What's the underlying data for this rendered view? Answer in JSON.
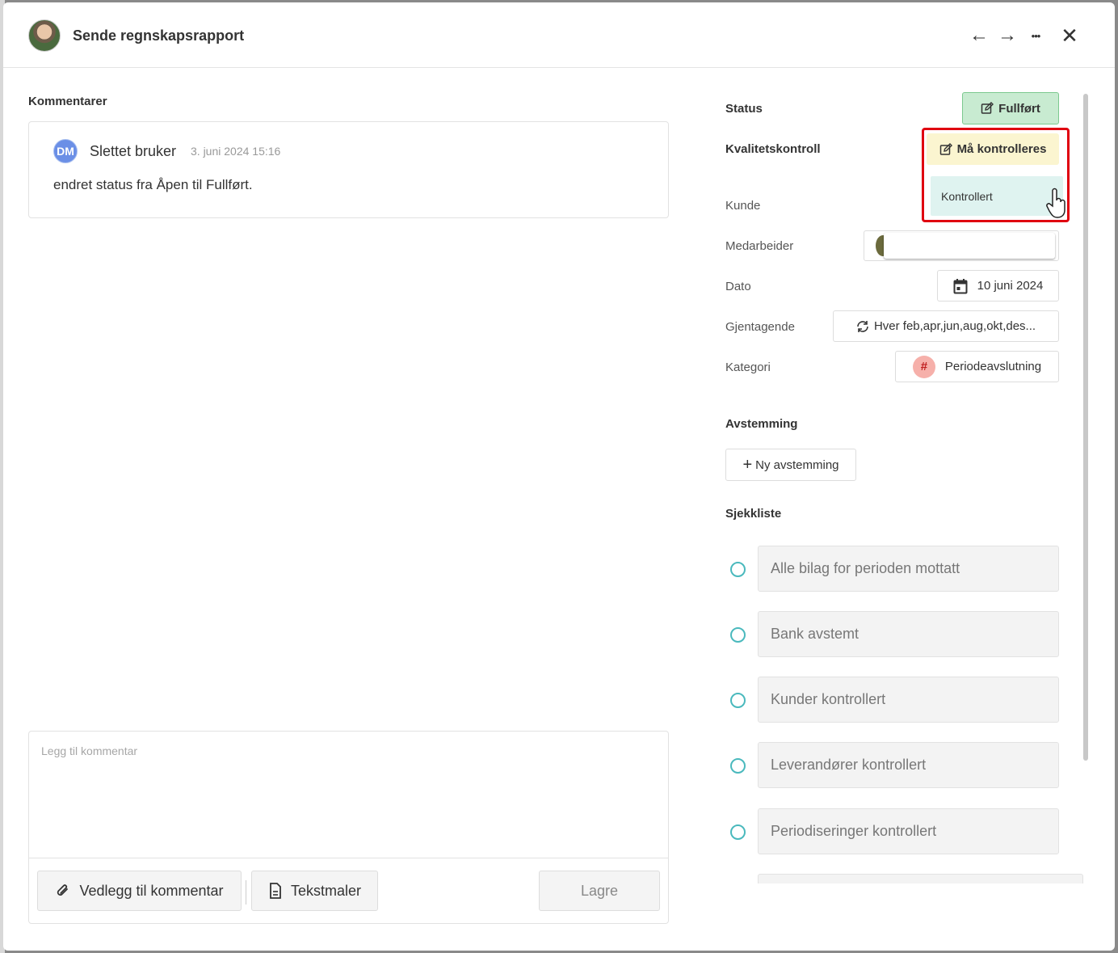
{
  "header": {
    "title": "Sende regnskapsrapport",
    "prev_icon": "←",
    "next_icon": "→",
    "more_icon": "•••",
    "close_icon": "✕"
  },
  "comments": {
    "section_label": "Kommentarer",
    "items": [
      {
        "avatar_initials": "DM",
        "author": "Slettet bruker",
        "timestamp": "3. juni 2024 15:16",
        "text": "endret status fra Åpen til Fullført."
      }
    ],
    "composer": {
      "placeholder": "Legg til kommentar",
      "attach_label": "Vedlegg til kommentar",
      "templates_label": "Tekstmaler",
      "save_label": "Lagre"
    }
  },
  "details": {
    "status_label": "Status",
    "status_value": "Fullført",
    "qc_label": "Kvalitetskontroll",
    "qc_value": "Må kontrolleres",
    "qc_dropdown_option": "Kontrollert",
    "customer_label": "Kunde",
    "employee_label": "Medarbeider",
    "date_label": "Dato",
    "date_value": "10 juni 2024",
    "recurring_label": "Gjentagende",
    "recurring_value": "Hver feb,apr,jun,aug,okt,des...",
    "category_label": "Kategori",
    "category_symbol": "#",
    "category_value": "Periodeavslutning"
  },
  "reconciliation": {
    "section_label": "Avstemming",
    "new_label": "Ny avstemming"
  },
  "checklist": {
    "section_label": "Sjekkliste",
    "items": [
      "Alle bilag for perioden mottatt",
      "Bank avstemt",
      "Kunder kontrollert",
      "Leverandører kontrollert",
      "Periodiseringer kontrollert"
    ]
  },
  "colors": {
    "status_bg": "#c8ebd1",
    "qc_bg": "#fbf5d0",
    "highlight": "#e00010",
    "radio": "#4ab9bd",
    "dm_avatar": "#6b8fe6",
    "category_tag": "#f6b0aa"
  }
}
